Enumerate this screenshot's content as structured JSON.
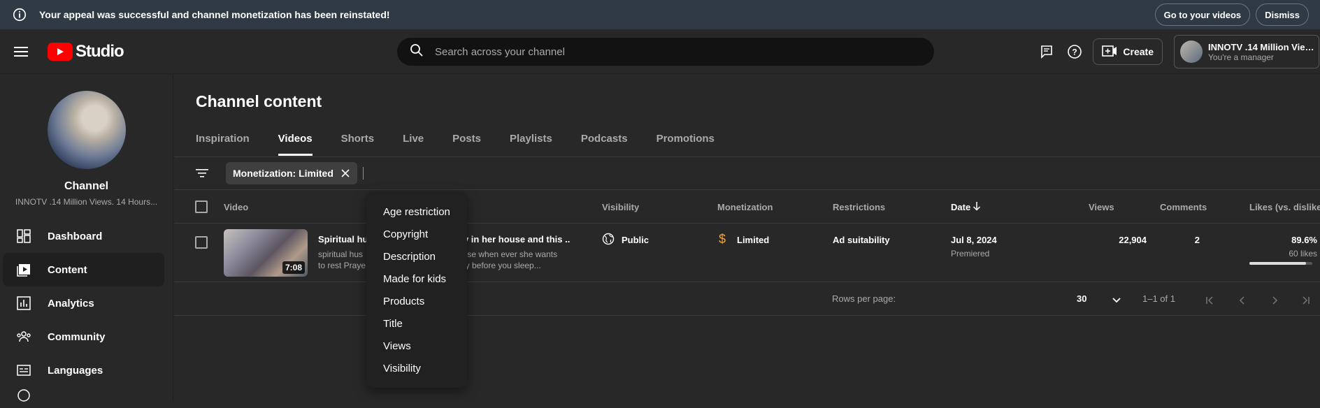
{
  "banner": {
    "message": "Your appeal was successful and channel monetization has been reinstated!",
    "go_button": "Go to your videos",
    "dismiss_button": "Dismiss"
  },
  "header": {
    "logo_text": "Studio",
    "search_placeholder": "Search across your channel",
    "create_label": "Create",
    "account_name": "INNOTV .14 Million View...",
    "account_role": "You're a manager"
  },
  "sidebar": {
    "channel_label": "Channel",
    "channel_name": "INNOTV .14 Million Views. 14 Hours...",
    "items": [
      {
        "label": "Dashboard",
        "icon": "dashboard-icon"
      },
      {
        "label": "Content",
        "icon": "content-icon"
      },
      {
        "label": "Analytics",
        "icon": "analytics-icon"
      },
      {
        "label": "Community",
        "icon": "community-icon"
      },
      {
        "label": "Languages",
        "icon": "languages-icon"
      }
    ]
  },
  "main": {
    "title": "Channel content",
    "tabs": [
      "Inspiration",
      "Videos",
      "Shorts",
      "Live",
      "Posts",
      "Playlists",
      "Podcasts",
      "Promotions"
    ],
    "active_tab": "Videos",
    "filter_chip": "Monetization: Limited",
    "columns": {
      "video": "Video",
      "visibility": "Visibility",
      "monetization": "Monetization",
      "restrictions": "Restrictions",
      "date": "Date",
      "views": "Views",
      "comments": "Comments",
      "likes": "Likes (vs. dislikes)"
    },
    "row": {
      "title": "Spiritual hus",
      "title_tail": "dy in her house and this ...",
      "desc1": "spiritual hus",
      "desc1_tail": "ouse when ever she wants",
      "desc2": "to rest Praye",
      "desc2_tail": "ray before you sleep...",
      "duration": "7:08",
      "visibility": "Public",
      "monetization": "Limited",
      "restrictions": "Ad suitability",
      "date": "Jul 8, 2024",
      "date_sub": "Premiered",
      "views": "22,904",
      "comments": "2",
      "likes_pct": "89.6%",
      "likes_count": "60 likes",
      "likes_fraction": 0.896
    },
    "pager": {
      "rows_label": "Rows per page:",
      "rows_value": "30",
      "range": "1–1 of 1"
    }
  },
  "filter_menu": [
    "Age restriction",
    "Copyright",
    "Description",
    "Made for kids",
    "Products",
    "Title",
    "Views",
    "Visibility"
  ],
  "colors": {
    "accent": "#3ea6ff",
    "brand": "#ff0000",
    "monetization_limited": "#f2a33a"
  }
}
